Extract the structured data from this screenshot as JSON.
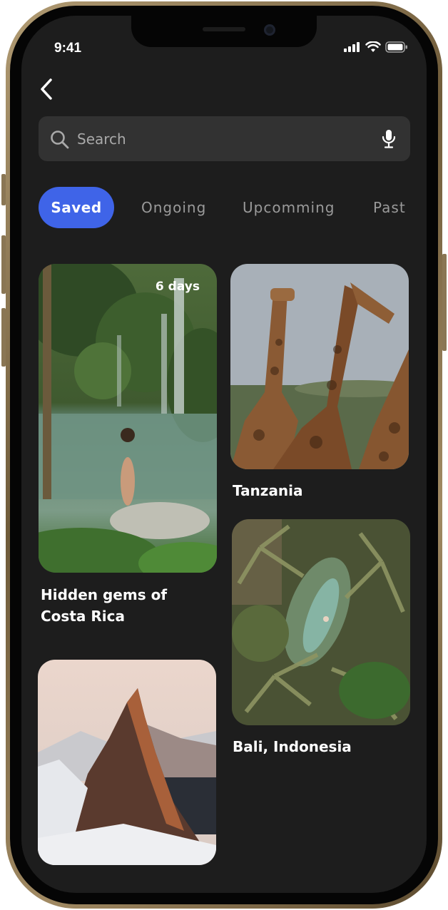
{
  "status_bar": {
    "time": "9:41"
  },
  "search": {
    "placeholder": "Search"
  },
  "tabs": [
    {
      "label": "Saved",
      "active": true
    },
    {
      "label": "Ongoing",
      "active": false
    },
    {
      "label": "Upcomming",
      "active": false
    },
    {
      "label": "Past",
      "active": false
    }
  ],
  "trips": [
    {
      "title": "Hidden gems of Costa Rica",
      "badge": "6 days",
      "image": "waterfall-lagoon"
    },
    {
      "title": "Tanzania",
      "image": "giraffes"
    },
    {
      "title": "Bali, Indonesia",
      "image": "palm-pool-aerial"
    },
    {
      "title": "",
      "image": "snowy-mountain"
    }
  ],
  "colors": {
    "accent": "#3f64e8",
    "background": "#1d1d1d",
    "search_bg": "#323232"
  }
}
